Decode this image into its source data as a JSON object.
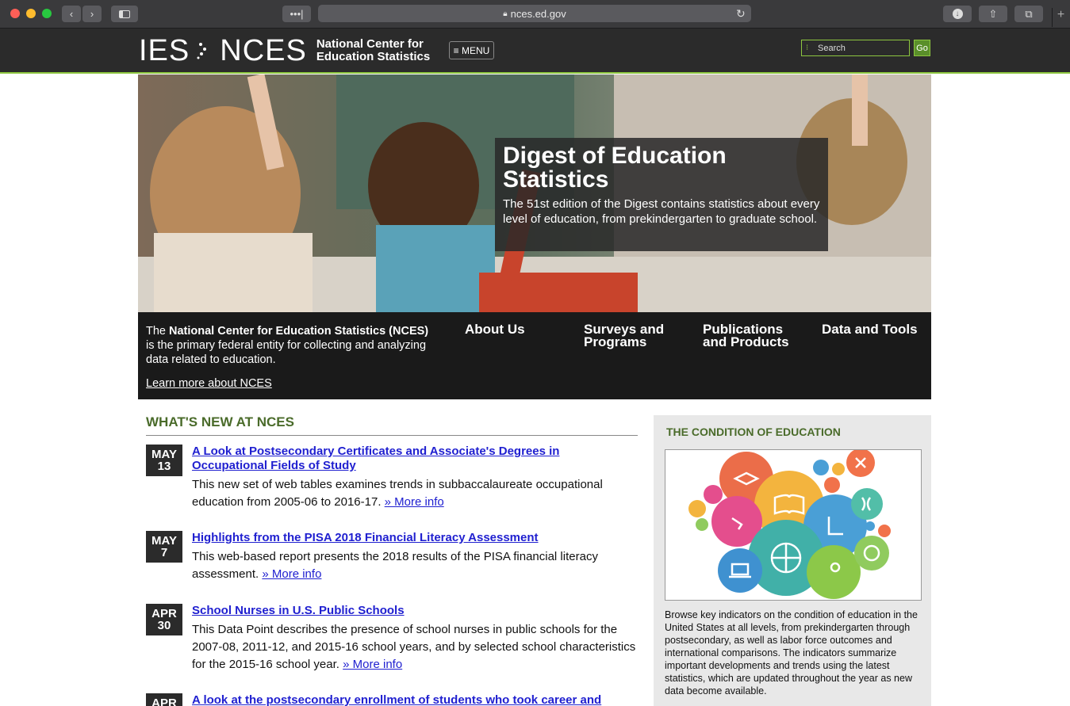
{
  "browser": {
    "url": "nces.ed.gov"
  },
  "header": {
    "logo_ies": "IES",
    "logo_nces": "NCES",
    "logo_line1": "National Center for",
    "logo_line2": "Education Statistics",
    "menu_label": "≡ MENU",
    "search_placeholder": "Search",
    "go_label": "Go"
  },
  "hero": {
    "title": "Digest of Education Statistics",
    "description": "The 51st edition of the Digest contains statistics about every level of education, from prekindergarten to graduate school."
  },
  "band": {
    "intro_pre": "The ",
    "intro_bold": "National Center for Education Statistics (NCES)",
    "intro_post": " is the primary federal entity for collecting and analyzing data related to education.",
    "learn_more": "Learn more about NCES",
    "nav": [
      "About Us",
      "Surveys and Programs",
      "Publications and Products",
      "Data and Tools"
    ]
  },
  "whats_new": {
    "title": "WHAT'S NEW AT NCES",
    "items": [
      {
        "month": "MAY",
        "day": "13",
        "title": "A Look at Postsecondary Certificates and Associate's Degrees in Occupational Fields of Study",
        "desc": "This new set of web tables examines trends in subbaccalaureate occupational education from 2005-06 to 2016-17.",
        "more": "» More info"
      },
      {
        "month": "MAY",
        "day": "7",
        "title": "Highlights from the PISA 2018 Financial Literacy Assessment",
        "desc": "This web-based report presents the 2018 results of the PISA financial literacy assessment.",
        "more": "» More info"
      },
      {
        "month": "APR",
        "day": "30",
        "title": "School Nurses in U.S. Public Schools",
        "desc": "This Data Point describes the presence of school nurses in public schools for the 2007-08, 2011-12, and 2015-16 school years, and by selected school characteristics for the 2015-16 school year.",
        "more": "» More info"
      },
      {
        "month": "APR",
        "day": "",
        "title": "A look at the postsecondary enrollment of students who took career and",
        "desc": "",
        "more": ""
      }
    ]
  },
  "condition": {
    "title": "THE CONDITION OF EDUCATION",
    "text": "Browse key indicators on the condition of education in the United States at all levels, from prekindergarten through postsecondary, as well as labor force outcomes and international comparisons. The indicators summarize important developments and trends using the latest statistics, which are updated throughout the year as new data become available."
  }
}
